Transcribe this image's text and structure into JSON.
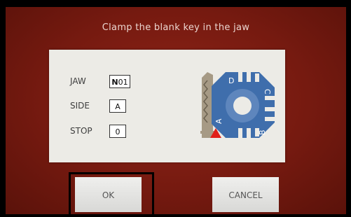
{
  "dialog": {
    "title": "Clamp the blank key in the jaw",
    "params": [
      {
        "label": "JAW",
        "value_bold": "N",
        "value_rest": "01"
      },
      {
        "label": "SIDE",
        "value_bold": "",
        "value_rest": "A"
      },
      {
        "label": "STOP",
        "value_bold": "",
        "value_rest": "0"
      }
    ],
    "diagram_labels": [
      "D",
      "C",
      "B",
      "A"
    ]
  },
  "buttons": {
    "ok_label": "OK",
    "cancel_label": "CANCEL"
  },
  "colors": {
    "background": "#7a1c12",
    "panel": "#ecebe6",
    "jaw_blue": "#3f6eac",
    "stop_red": "#e0201a"
  }
}
